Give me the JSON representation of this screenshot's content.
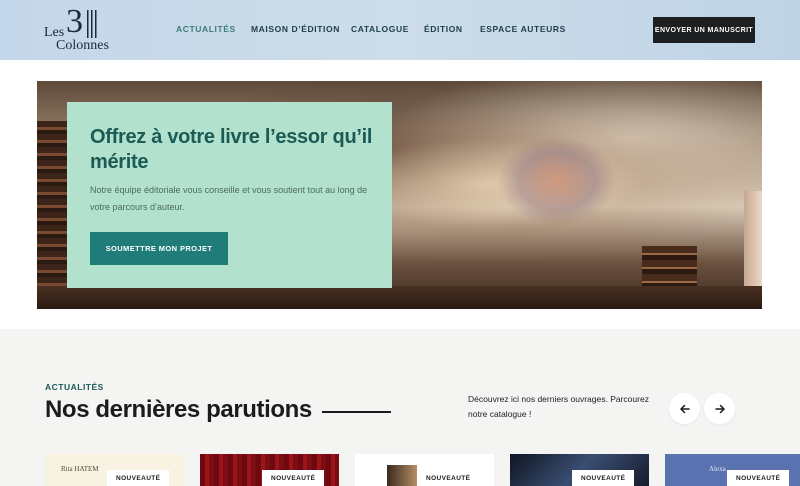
{
  "logo": {
    "line1": "Les",
    "number": "3",
    "line2": "Colonnes"
  },
  "nav": {
    "items": [
      {
        "label": "ACTUALITÉS",
        "active": true
      },
      {
        "label": "MAISON D’ÉDITION",
        "active": false
      },
      {
        "label": "CATALOGUE",
        "active": false
      },
      {
        "label": "ÉDITION",
        "active": false
      },
      {
        "label": "ESPACE AUTEURS",
        "active": false
      }
    ],
    "cta_label": "ENVOYER UN MANUSCRIT"
  },
  "hero": {
    "title": "Offrez à votre livre l’essor qu’il mérite",
    "subtitle": "Notre équipe éditoriale vous conseille et vous soutient tout au long de votre parcours d’auteur.",
    "button_label": "SOUMETTRE MON PROJET"
  },
  "news": {
    "kicker": "ACTUALITÉS",
    "title": "Nos dernières parutions",
    "description": "Découvrez ici nos derniers ouvrages. Parcourez notre catalogue !",
    "prev_icon": "arrow-left-icon",
    "next_icon": "arrow-right-icon",
    "books": [
      {
        "badge": "NOUVEAUTÉ",
        "author": "Rita HATEM",
        "cover_color": "#f7f2e1"
      },
      {
        "badge": "NOUVEAUTÉ",
        "author": "",
        "cover_color": "#8a0f14"
      },
      {
        "badge": "NOUVEAUTÉ",
        "author": "",
        "cover_color": "#ffffff"
      },
      {
        "badge": "NOUVEAUTÉ",
        "author": "",
        "cover_color": "#1c2436"
      },
      {
        "badge": "NOUVEAUTÉ",
        "author": "Alexa",
        "cover_color": "#5b72b0"
      }
    ]
  },
  "colors": {
    "accent_green": "#1b5a55",
    "button_teal": "#1f7c78",
    "hero_card": "#b2e2cd",
    "header_bg": "#c9dae9",
    "dark_button": "#1d1f21"
  }
}
